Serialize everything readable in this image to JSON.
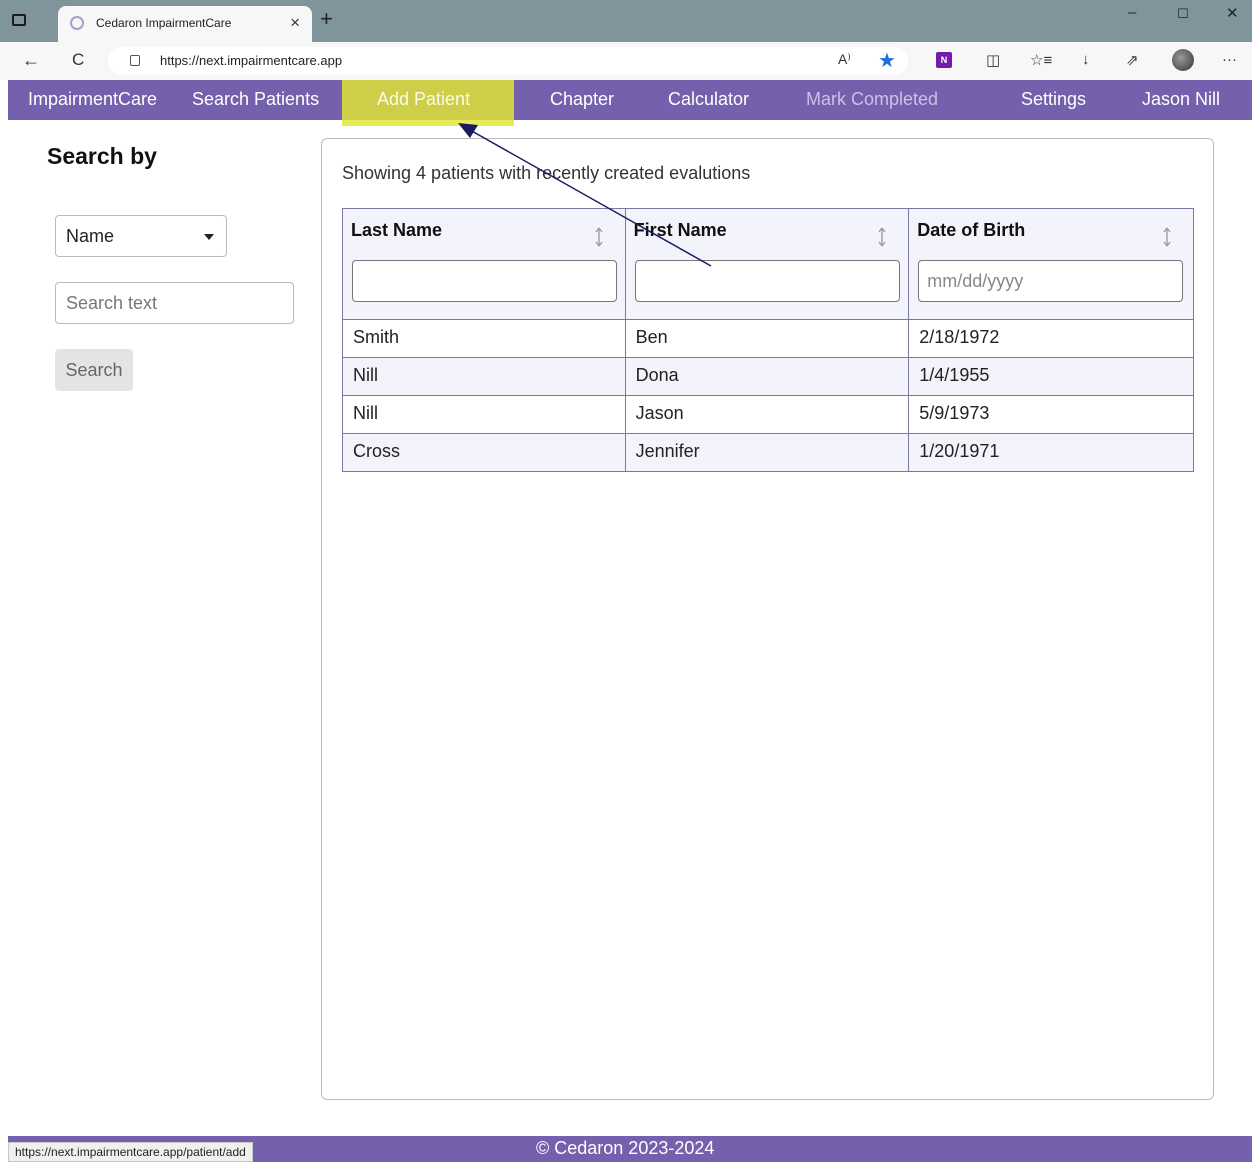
{
  "browser": {
    "tab_title": "Cedaron ImpairmentCare",
    "tab_close": "×",
    "new_tab": "+",
    "url": "https://next.impairmentcare.app",
    "read_aloud": "A⁾",
    "status_url": "https://next.impairmentcare.app/patient/add",
    "controls": {
      "minimize": "–",
      "maximize": "☐",
      "close": "✕"
    },
    "nav": {
      "back": "←",
      "refresh": "C"
    },
    "toolbar": {
      "split": "◫",
      "favorites": "☆≡",
      "downloads": "↓",
      "share": "⇗",
      "more": "···",
      "onenote": "N"
    }
  },
  "nav": {
    "brand": "ImpairmentCare",
    "search_patients": "Search Patients",
    "add_patient": "Add Patient",
    "chapter": "Chapter",
    "calculator": "Calculator",
    "mark_completed": "Mark Completed",
    "settings": "Settings",
    "user": "Jason Nill"
  },
  "sidebar": {
    "heading": "Search by",
    "select_value": "Name",
    "search_placeholder": "Search text",
    "search_button": "Search"
  },
  "main": {
    "summary": "Showing 4 patients with recently created evalutions",
    "columns": [
      "Last Name",
      "First Name",
      "Date of Birth"
    ],
    "dob_placeholder": "mm/dd/yyyy",
    "rows": [
      [
        "Smith",
        "Ben",
        "2/18/1972"
      ],
      [
        "Nill",
        "Dona",
        "1/4/1955"
      ],
      [
        "Nill",
        "Jason",
        "5/9/1973"
      ],
      [
        "Cross",
        "Jennifer",
        "1/20/1971"
      ]
    ]
  },
  "footer": {
    "copyright": "© Cedaron 2023-2024"
  },
  "colors": {
    "nav_bg": "#7460ac",
    "highlight": "#e2e632",
    "arrow": "#1c1a5e"
  }
}
